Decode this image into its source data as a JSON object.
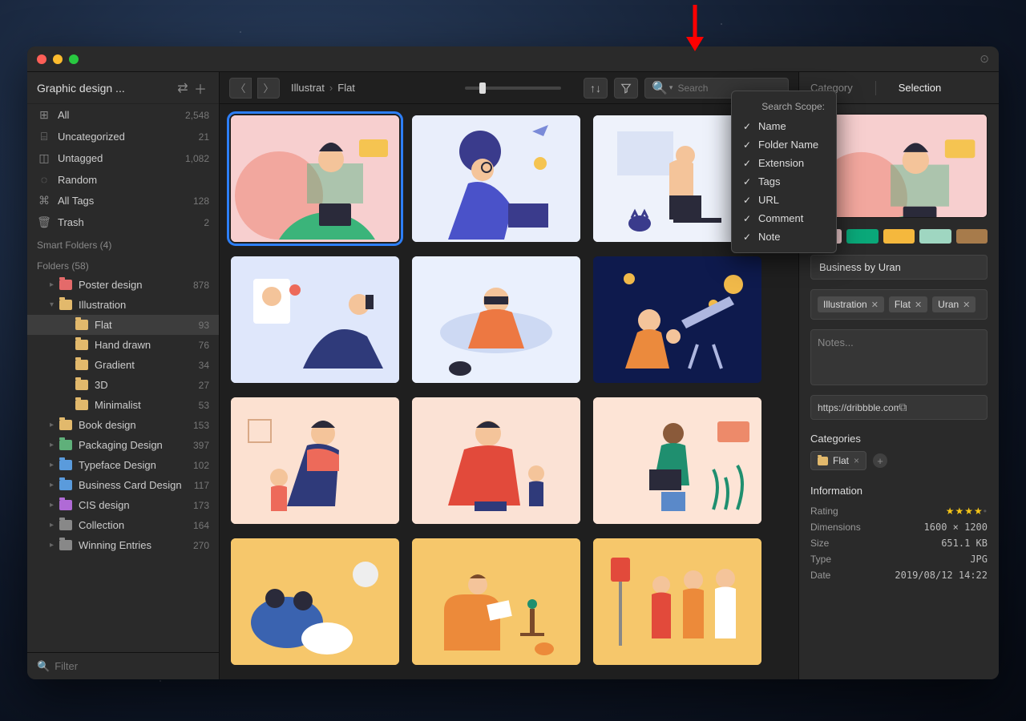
{
  "window": {
    "library_name": "Graphic design ..."
  },
  "sidebar": {
    "smart_label": "Smart Folders (4)",
    "folders_label": "Folders (58)",
    "items": [
      {
        "icon": "⊞",
        "label": "All",
        "count": "2,548"
      },
      {
        "icon": "⌸",
        "label": "Uncategorized",
        "count": "21"
      },
      {
        "icon": "◫",
        "label": "Untagged",
        "count": "1,082"
      },
      {
        "icon": "◌",
        "label": "Random",
        "count": ""
      },
      {
        "icon": "⌘",
        "label": "All Tags",
        "count": "128"
      },
      {
        "icon": "🗑",
        "label": "Trash",
        "count": "2"
      }
    ],
    "folders": [
      {
        "caret": "▸",
        "color": "#e46a6a",
        "label": "Poster design",
        "count": "878",
        "depth": 1
      },
      {
        "caret": "▾",
        "color": "#e2b96c",
        "label": "Illustration",
        "count": "",
        "depth": 1
      },
      {
        "caret": "",
        "color": "#e2b96c",
        "label": "Flat",
        "count": "93",
        "depth": 2,
        "selected": true
      },
      {
        "caret": "",
        "color": "#e2b96c",
        "label": "Hand drawn",
        "count": "76",
        "depth": 2
      },
      {
        "caret": "",
        "color": "#e2b96c",
        "label": "Gradient",
        "count": "34",
        "depth": 2
      },
      {
        "caret": "",
        "color": "#e2b96c",
        "label": "3D",
        "count": "27",
        "depth": 2
      },
      {
        "caret": "",
        "color": "#e2b96c",
        "label": "Minimalist",
        "count": "53",
        "depth": 2
      },
      {
        "caret": "▸",
        "color": "#e2b96c",
        "label": "Book design",
        "count": "153",
        "depth": 1
      },
      {
        "caret": "▸",
        "color": "#5fb07a",
        "label": "Packaging Design",
        "count": "397",
        "depth": 1
      },
      {
        "caret": "▸",
        "color": "#5a9bdc",
        "label": "Typeface Design",
        "count": "102",
        "depth": 1
      },
      {
        "caret": "▸",
        "color": "#5a9bdc",
        "label": "Business Card Design",
        "count": "117",
        "depth": 1
      },
      {
        "caret": "▸",
        "color": "#b06ad6",
        "label": "CIS design",
        "count": "173",
        "depth": 1
      },
      {
        "caret": "▸",
        "color": "#888",
        "label": "Collection",
        "count": "164",
        "depth": 1
      },
      {
        "caret": "▸",
        "color": "#888",
        "label": "Winning Entries",
        "count": "270",
        "depth": 1
      }
    ],
    "filter_placeholder": "Filter"
  },
  "toolbar": {
    "crumb1": "Illustrat",
    "crumb2": "Flat",
    "search_placeholder": "Search"
  },
  "search_popup": {
    "header": "Search Scope:",
    "options": [
      "Name",
      "Folder Name",
      "Extension",
      "Tags",
      "URL",
      "Comment",
      "Note"
    ]
  },
  "thumbnails": [
    {
      "bg": "#f7cfcf",
      "selected": true,
      "svg": "person-desk-green"
    },
    {
      "bg": "#e9eefb",
      "svg": "woman-laptop-blue"
    },
    {
      "bg": "#eef2fb",
      "svg": "man-chair-cat"
    },
    {
      "bg": "#dfe7fb",
      "svg": "couple-phone"
    },
    {
      "bg": "#eaf0fd",
      "svg": "vr-guy"
    },
    {
      "bg": "#0e1a4d",
      "svg": "family-telescope"
    },
    {
      "bg": "#fce1d1",
      "svg": "dad-daughter"
    },
    {
      "bg": "#fbe2d5",
      "svg": "man-child-red"
    },
    {
      "bg": "#fde4d6",
      "svg": "woman-laptop-plants"
    },
    {
      "bg": "#f6c76b",
      "svg": "couple-couch"
    },
    {
      "bg": "#f6c76b",
      "svg": "oldman-reading"
    },
    {
      "bg": "#f6c76b",
      "svg": "bus-stop"
    }
  ],
  "rightpanel": {
    "tab1": "Category",
    "tab2": "Selection",
    "swatches": [
      "#f4cfd1",
      "#0aa879",
      "#f5b83d",
      "#9fd6c1",
      "#a77b4b"
    ],
    "title": "Business by Uran",
    "tags": [
      "Illustration",
      "Flat",
      "Uran"
    ],
    "notes_placeholder": "Notes...",
    "url": "https://dribbble.com/ur",
    "categories_label": "Categories",
    "category_chip": "Flat",
    "info_label": "Information",
    "info": [
      {
        "k": "Rating",
        "v": "",
        "stars": 4
      },
      {
        "k": "Dimensions",
        "v": "1600 × 1200"
      },
      {
        "k": "Size",
        "v": "651.1 KB"
      },
      {
        "k": "Type",
        "v": "JPG"
      },
      {
        "k": "Date",
        "v": "2019/08/12 14:22"
      }
    ]
  }
}
